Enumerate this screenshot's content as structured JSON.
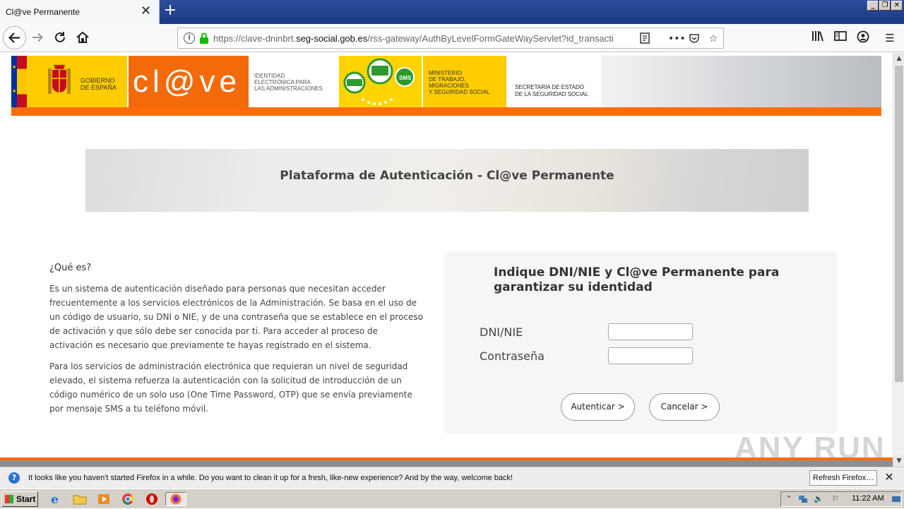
{
  "browser": {
    "tab_title": "Cl@ve Permanente",
    "tab_close": "✕",
    "new_tab": "+",
    "window_buttons": [
      "_",
      "❐",
      "✕"
    ],
    "url_prefix": "https://clave-dninbrt.",
    "url_domain": "seg-social.gob.es",
    "url_path": "/rss-gateway/AuthByLevelFormGateWayServlet?id_transacti",
    "icons": {
      "back": "back-arrow-icon",
      "forward": "forward-arrow-icon",
      "reload": "reload-icon",
      "home": "home-icon",
      "info": "info-icon",
      "lock": "lock-icon",
      "reader": "reader-view-icon",
      "more": "more-icon",
      "pocket": "pocket-icon",
      "bookmark": "star-icon",
      "library": "library-icon",
      "sidebar": "sidebar-icon",
      "account": "account-icon",
      "menu": "hamburger-menu-icon"
    }
  },
  "banner": {
    "gobierno": [
      "GOBIERNO",
      "DE ESPAÑA"
    ],
    "clave_logo": "cl@ve",
    "identidad": [
      "IDENTIDAD",
      "ELECTRÓNICA PARA",
      "LAS ADMINISTRACIONES"
    ],
    "sms_badge": "SMS",
    "ministerio": [
      "MINISTERIO",
      "DE TRABAJO,",
      "MIGRACIONES",
      "Y SEGURIDAD SOCIAL"
    ],
    "secretaria": [
      "SECRETARÍA DE ESTADO",
      "DE LA SEGURIDAD SOCIAL"
    ],
    "colors": {
      "orange": "#ff6c0a",
      "yellow": "#ffcc00"
    }
  },
  "hero": {
    "title": "Plataforma de Autenticación - Cl@ve Permanente"
  },
  "info": {
    "heading": "¿Qué es?",
    "paragraphs": [
      "Es un sistema de autenticación diseñado para personas que necesitan acceder frecuentemente a los servicios electrónicos de la Administración. Se basa en el uso de un código de usuario, su DNI o NIE, y de una contraseña que se establece en el proceso de activación y que sólo debe ser conocida por ti. Para acceder al proceso de activación es necesario que previamente te hayas registrado en el sistema.",
      "Para los servicios de administración electrónica que requieran un nivel de seguridad elevado, el sistema refuerza la autenticación con la solicitud de introducción de un código numérico de un solo uso (One Time Password, OTP) que se envía previamente por mensaje SMS a tu teléfono móvil."
    ]
  },
  "login": {
    "title": "Indique DNI/NIE y Cl@ve Permanente para garantizar su identidad",
    "dni_label": "DNI/NIE",
    "dni_value": "",
    "password_label": "Contraseña",
    "password_value": "",
    "submit_label": "Autenticar >",
    "cancel_label": "Cancelar >"
  },
  "watermark": "ANY RUN",
  "notification": {
    "text": "It looks like you haven't started Firefox in a while. Do you want to clean it up for a fresh, like-new experience? And by the way, welcome back!",
    "button": "Refresh Firefox…",
    "close": "✕"
  },
  "taskbar": {
    "start_label": "Start",
    "clock": "11:22 AM"
  }
}
